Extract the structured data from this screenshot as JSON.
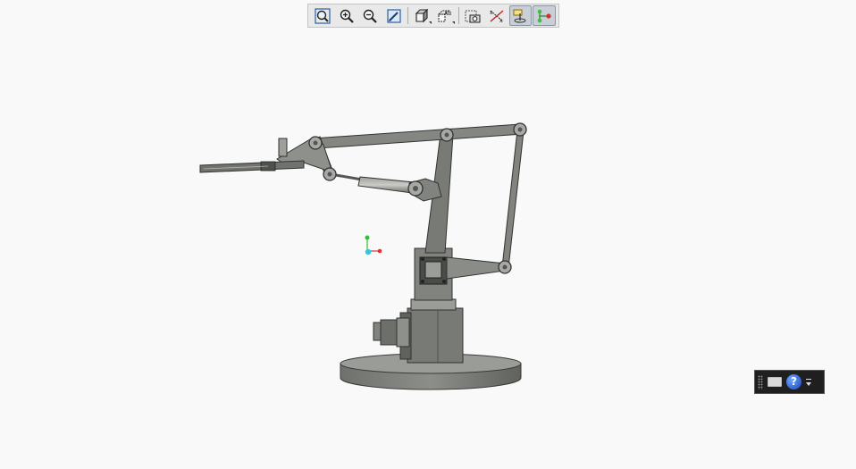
{
  "toolbar": {
    "buttons": [
      {
        "name": "zoom-fit",
        "icon": "magnifier-window-icon",
        "active": false
      },
      {
        "name": "zoom-in",
        "icon": "zoom-in-icon",
        "active": false
      },
      {
        "name": "zoom-out",
        "icon": "zoom-out-icon",
        "active": false
      },
      {
        "name": "view-orientation",
        "icon": "pencil-view-icon",
        "active": false
      },
      {
        "name": "display-style",
        "icon": "shaded-cube-icon",
        "active": false,
        "dropdown": true
      },
      {
        "name": "saved-views",
        "icon": "named-views-icon",
        "active": false,
        "dropdown": true
      },
      {
        "name": "screenshot",
        "icon": "camera-icon",
        "active": false
      },
      {
        "name": "datum-display",
        "icon": "datum-planes-icon",
        "active": false
      },
      {
        "name": "spin-center",
        "icon": "spin-center-icon",
        "active": true
      },
      {
        "name": "connections",
        "icon": "connection-graph-icon",
        "active": true
      }
    ]
  },
  "viewport": {
    "model": "robot-arm-assembly",
    "axes": {
      "x_color": "#e03030",
      "y_color": "#30c030",
      "origin_color": "#30c8e0"
    }
  },
  "mini_toolbar": {
    "help_label": "?",
    "icons": [
      "grip-icon",
      "keyboard-icon",
      "help-icon",
      "options-chevron-icon"
    ]
  }
}
